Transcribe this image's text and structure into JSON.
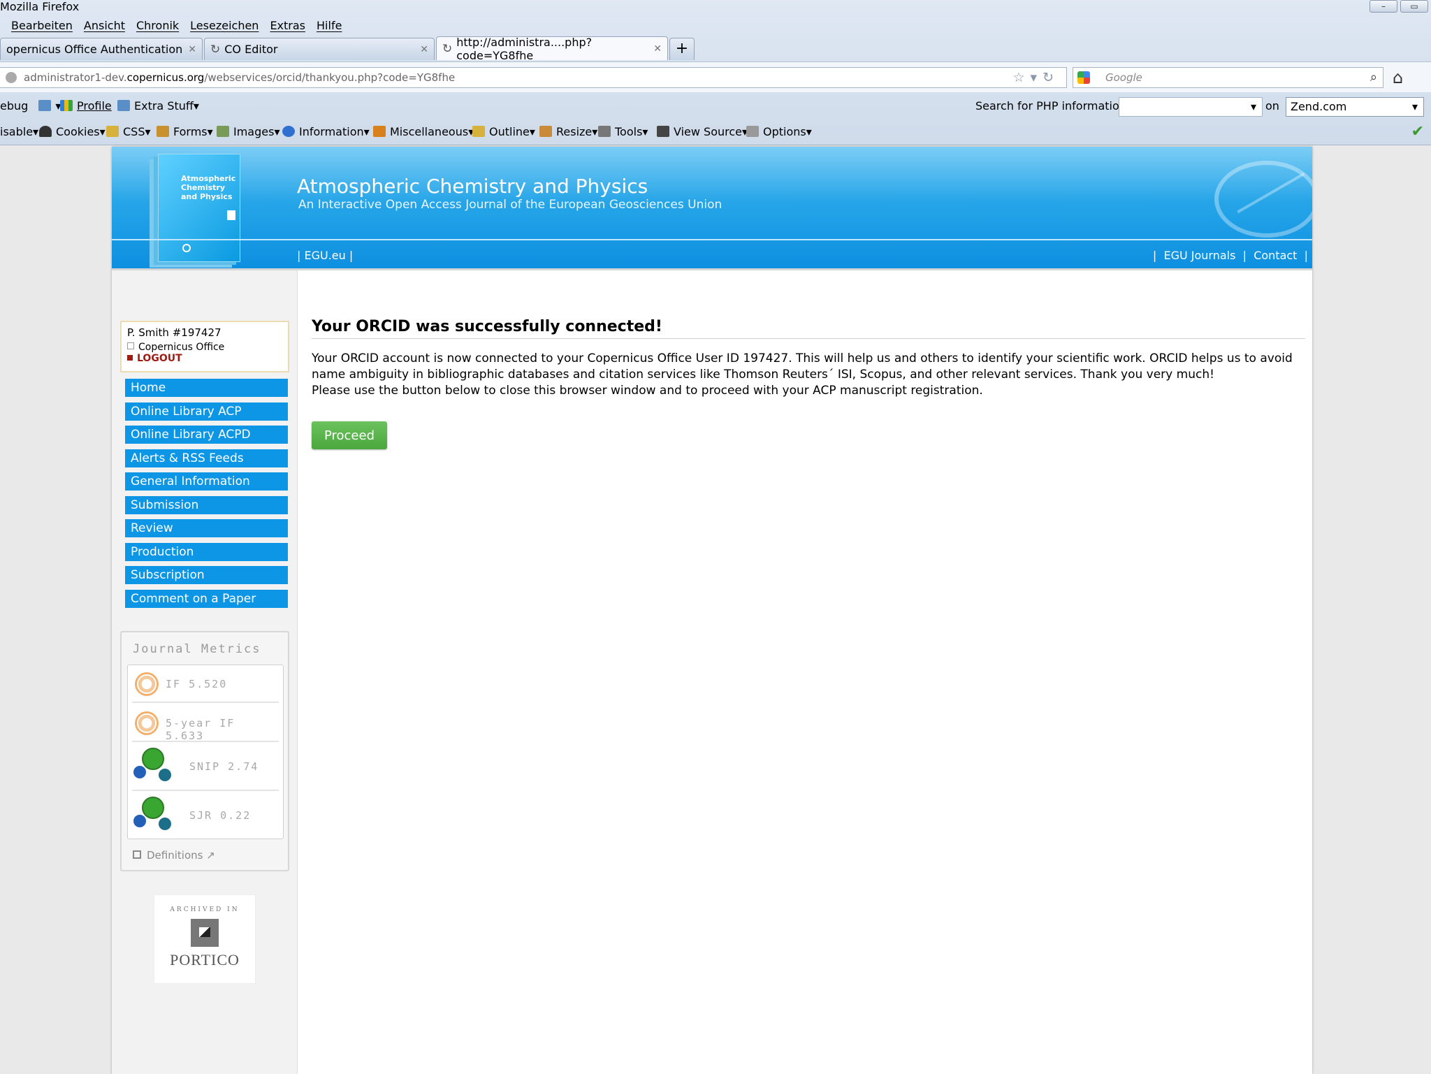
{
  "browser": {
    "window_title": "Mozilla Firefox",
    "menu": [
      "Bearbeiten",
      "Ansicht",
      "Chronik",
      "Lesezeichen",
      "Extras",
      "Hilfe"
    ],
    "tabs": [
      {
        "label": "opernicus Office Authentication",
        "active": false
      },
      {
        "label": "CO Editor",
        "active": false
      },
      {
        "label": "http://administra....php?code=YG8fhe",
        "active": true
      }
    ],
    "new_tab_label": "+",
    "url": {
      "prefix": "administrator1-dev.",
      "host": "copernicus.org",
      "path": "/webservices/orcid/thankyou.php?code=YG8fhe"
    },
    "search_placeholder": "Google",
    "devbar1": {
      "debug": "ebug",
      "profile": "Profile",
      "extra_stuff": "Extra Stuff",
      "php_label": "Search for PHP information:",
      "php_value": "",
      "on_label": "on",
      "zend_value": "Zend.com"
    },
    "devbar2": [
      "isable",
      "Cookies",
      "CSS",
      "Forms",
      "Images",
      "Information",
      "Miscellaneous",
      "Outline",
      "Resize",
      "Tools",
      "View Source",
      "Options"
    ]
  },
  "site": {
    "cover_text": "Atmospheric Chemistry and Physics",
    "title": "Atmospheric Chemistry and Physics",
    "subtitle": "An Interactive Open Access Journal of the European Geosciences Union",
    "left_links": "|  EGU.eu  |",
    "right_links": [
      "EGU Journals",
      "Contact"
    ],
    "user": {
      "name": "P. Smith #197427",
      "org": "Copernicus Office",
      "logout": "LOGOUT"
    },
    "nav": [
      "Home",
      "Online Library ACP",
      "Online Library ACPD",
      "Alerts & RSS Feeds",
      "General Information",
      "Submission",
      "Review",
      "Production",
      "Subscription",
      "Comment on a Paper"
    ],
    "metrics": {
      "heading": "Journal Metrics",
      "items": [
        "IF 5.520",
        "5-year IF 5.633",
        "SNIP 2.74",
        "SJR 0.22"
      ],
      "definitions": "Definitions"
    },
    "portico": {
      "archived": "ARCHIVED IN",
      "name": "PORTICO"
    },
    "content": {
      "heading": "Your ORCID was successfully connected!",
      "para1": "Your ORCID account is now connected to your Copernicus Office User ID 197427. This will help us and others to identify your scientific work. ORCID helps us to avoid name ambiguity in bibliographic databases and citation services like Thomson Reuters´ ISI, Scopus, and other relevant services. Thank you very much!",
      "para2": "Please use the button below to close this browser window and to proceed with your ACP manuscript registration.",
      "proceed": "Proceed"
    }
  }
}
